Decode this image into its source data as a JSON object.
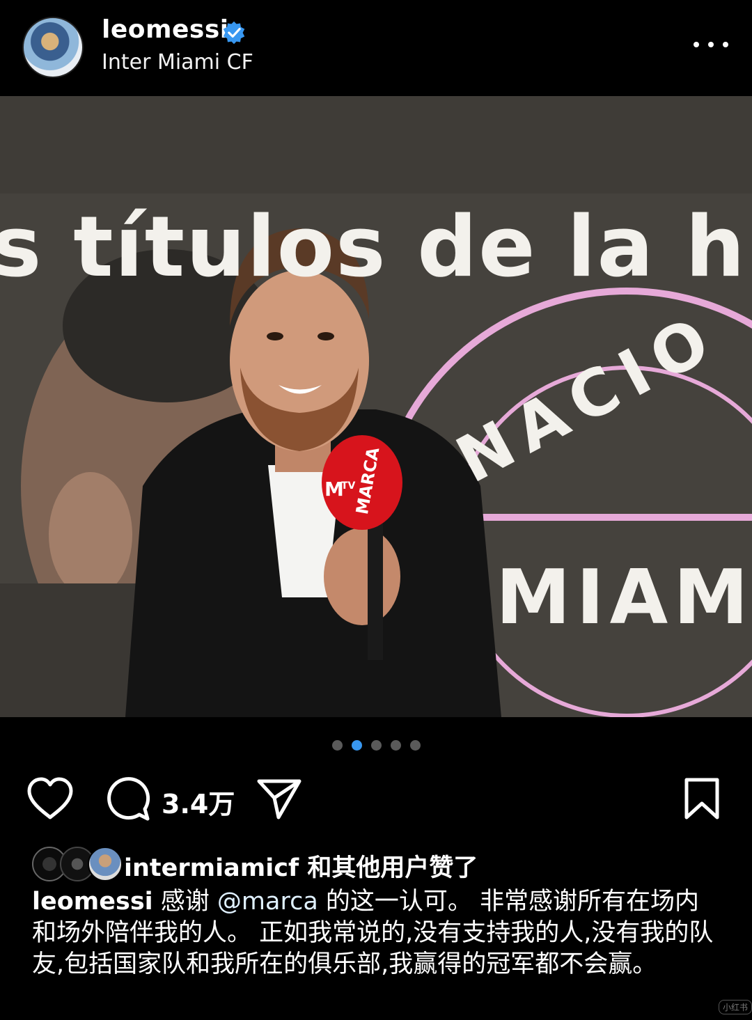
{
  "header": {
    "username": "leomessi",
    "location": "Inter Miami CF",
    "verified_color": "#3897f0"
  },
  "photo": {
    "screen_text": "s títulos de la hist",
    "sign_text_top": "NACIO",
    "sign_text_mid": "MIAM",
    "mic_brand": "MARCA",
    "mic_logo": "M",
    "mic_tv": "TV"
  },
  "carousel": {
    "count": 5,
    "active_index": 1,
    "active_color": "#3897f0"
  },
  "actions": {
    "comment_count": "3.4万",
    "icons": [
      "heart-icon",
      "comment-icon",
      "share-icon",
      "bookmark-icon"
    ]
  },
  "likes": {
    "text": "intermiamicf 和其他用户赞了"
  },
  "caption": {
    "user": "leomessi",
    "part1": " 感谢 ",
    "mention": "@marca",
    "part2": " 的这一认可。 非常感谢所有在场内和场外陪伴我的人。 正如我常说的,没有支持我的人,没有我的队友,包括国家队和我所在的俱乐部,我赢得的冠军都不会赢。"
  },
  "watermark": "小红书"
}
